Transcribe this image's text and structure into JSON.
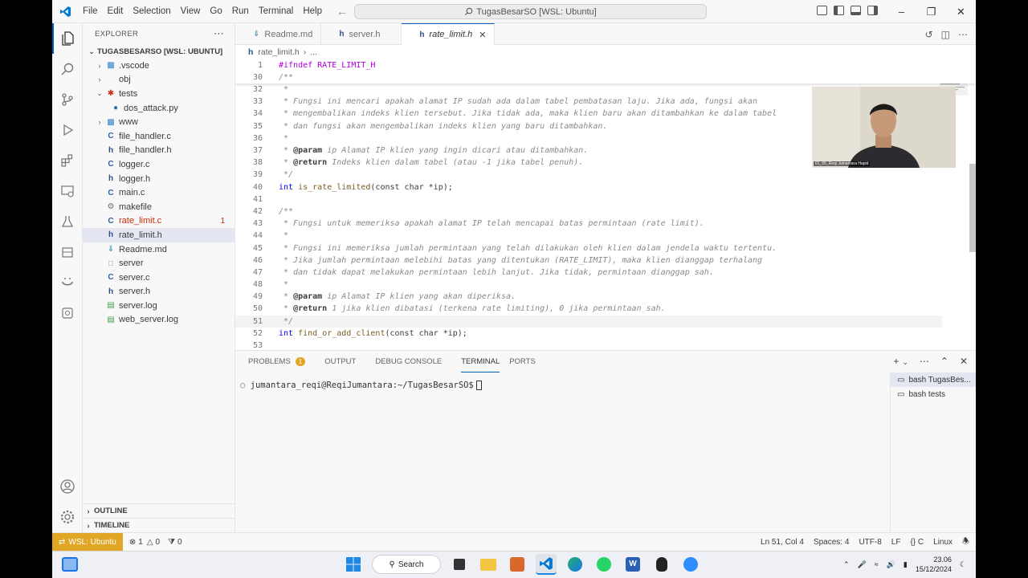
{
  "titlebar": {
    "menu": [
      "File",
      "Edit",
      "Selection",
      "View",
      "Go",
      "Run",
      "Terminal",
      "Help"
    ],
    "command_center": "TugasBesarSO [WSL: Ubuntu]"
  },
  "sidebar": {
    "header": "EXPLORER",
    "workspace": "TUGASBESARSO [WSL: UBUNTU]",
    "items": [
      {
        "label": ".vscode",
        "type": "folder",
        "icon": "vscode-folder-icon"
      },
      {
        "label": "obj",
        "type": "folder",
        "icon": "folder-icon"
      },
      {
        "label": "tests",
        "type": "folder-open",
        "icon": "tests-folder-icon"
      },
      {
        "label": "dos_attack.py",
        "type": "file",
        "icon": "python-icon"
      },
      {
        "label": "www",
        "type": "folder",
        "icon": "web-folder-icon"
      },
      {
        "label": "file_handler.c",
        "type": "file",
        "icon": "c-icon"
      },
      {
        "label": "file_handler.h",
        "type": "file",
        "icon": "h-icon"
      },
      {
        "label": "logger.c",
        "type": "file",
        "icon": "c-icon"
      },
      {
        "label": "logger.h",
        "type": "file",
        "icon": "h-icon"
      },
      {
        "label": "main.c",
        "type": "file",
        "icon": "c-icon"
      },
      {
        "label": "makefile",
        "type": "file",
        "icon": "makefile-icon"
      },
      {
        "label": "rate_limit.c",
        "type": "file",
        "icon": "c-icon",
        "badge": "1",
        "error": true
      },
      {
        "label": "rate_limit.h",
        "type": "file",
        "icon": "h-icon",
        "selected": true
      },
      {
        "label": "Readme.md",
        "type": "file",
        "icon": "markdown-icon"
      },
      {
        "label": "server",
        "type": "file",
        "icon": "file-icon"
      },
      {
        "label": "server.c",
        "type": "file",
        "icon": "c-icon"
      },
      {
        "label": "server.h",
        "type": "file",
        "icon": "h-icon"
      },
      {
        "label": "server.log",
        "type": "file",
        "icon": "log-icon"
      },
      {
        "label": "web_server.log",
        "type": "file",
        "icon": "log-icon"
      }
    ],
    "outline": "OUTLINE",
    "timeline": "TIMELINE"
  },
  "tabs": [
    {
      "label": "Readme.md",
      "icon": "markdown-icon"
    },
    {
      "label": "server.h",
      "icon": "h-icon"
    },
    {
      "label": "rate_limit.h",
      "icon": "h-icon",
      "active": true
    }
  ],
  "breadcrumb": {
    "file": "rate_limit.h",
    "more": "..."
  },
  "editor": {
    "sticky": [
      {
        "n": "1",
        "text": "#ifndef RATE_LIMIT_H"
      },
      {
        "n": "30",
        "text": "/**"
      }
    ],
    "lines": [
      {
        "n": "32",
        "text": " *"
      },
      {
        "n": "33",
        "text": " * Fungsi ini mencari apakah alamat IP sudah ada dalam tabel pembatasan laju. Jika ada, fungsi akan"
      },
      {
        "n": "34",
        "text": " * mengembalikan indeks klien tersebut. Jika tidak ada, maka klien baru akan ditambahkan ke dalam tabel"
      },
      {
        "n": "35",
        "text": " * dan fungsi akan mengembalikan indeks klien yang baru ditambahkan."
      },
      {
        "n": "36",
        "text": " *"
      },
      {
        "n": "37",
        "tag": "@param",
        "pre": " * ",
        "text": " ip Alamat IP klien yang ingin dicari atau ditambahkan."
      },
      {
        "n": "38",
        "tag": "@return",
        "pre": " * ",
        "text": " Indeks klien dalam tabel (atau -1 jika tabel penuh)."
      },
      {
        "n": "39",
        "text": " */"
      },
      {
        "n": "40",
        "code": "decl1"
      },
      {
        "n": "41",
        "text": ""
      },
      {
        "n": "42",
        "text": "/**"
      },
      {
        "n": "43",
        "text": " * Fungsi untuk memeriksa apakah alamat IP telah mencapai batas permintaan (rate limit)."
      },
      {
        "n": "44",
        "text": " *"
      },
      {
        "n": "45",
        "text": " * Fungsi ini memeriksa jumlah permintaan yang telah dilakukan oleh klien dalam jendela waktu tertentu."
      },
      {
        "n": "46",
        "text": " * Jika jumlah permintaan melebihi batas yang ditentukan (RATE_LIMIT), maka klien dianggap terhalang"
      },
      {
        "n": "47",
        "text": " * dan tidak dapat melakukan permintaan lebih lanjut. Jika tidak, permintaan dianggap sah."
      },
      {
        "n": "48",
        "text": " *"
      },
      {
        "n": "49",
        "tag": "@param",
        "pre": " * ",
        "text": " ip Alamat IP klien yang akan diperiksa."
      },
      {
        "n": "50",
        "tag": "@return",
        "pre": " * ",
        "text": " 1 jika klien dibatasi (terkena rate limiting), 0 jika permintaan sah."
      },
      {
        "n": "51",
        "text": " */",
        "current": true
      },
      {
        "n": "52",
        "code": "decl2"
      },
      {
        "n": "53",
        "text": ""
      }
    ],
    "decl1": {
      "type": "int",
      "name": "is_rate_limited",
      "args": "(const char *ip);"
    },
    "decl2": {
      "type": "int",
      "name": "find_or_add_client",
      "args": "(const char *ip);"
    }
  },
  "webcam": {
    "caption": "01_05_Reqi Jumantara Hapid"
  },
  "panel": {
    "tabs": [
      "PROBLEMS",
      "OUTPUT",
      "DEBUG CONSOLE",
      "TERMINAL",
      "PORTS"
    ],
    "problems_count": "1",
    "active": "TERMINAL",
    "prompt": "jumantara_reqi@ReqiJumantara:~/TugasBesarSO$",
    "terminals": [
      "bash  TugasBes...",
      "bash  tests"
    ]
  },
  "status": {
    "remote": "WSL: Ubuntu",
    "errors": "1",
    "warnings": "0",
    "ports": "0",
    "position": "Ln 51, Col 4",
    "spaces": "Spaces: 4",
    "encoding": "UTF-8",
    "eol": "LF",
    "language_mode": "{} C",
    "os": "Linux"
  },
  "taskbar": {
    "search": "Search",
    "time": "23.06",
    "date": "15/12/2024"
  },
  "colors": {
    "accent": "#005fb8",
    "remote_bg": "#e2a626",
    "error": "#c72e0f"
  }
}
